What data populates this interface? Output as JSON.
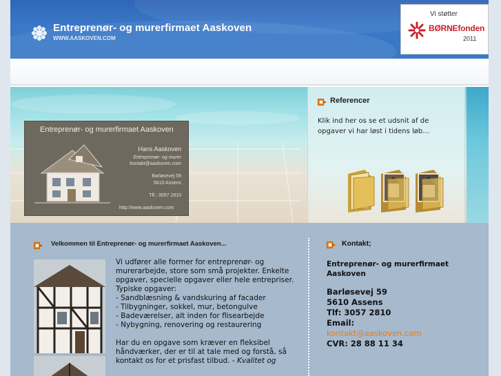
{
  "header": {
    "title": "Entreprenør- og murerfirmaet Aaskoven",
    "url": "WWW.AASKOVEN.COM"
  },
  "badge": {
    "top_text": "Vi støtter",
    "name": "BØRNEfonden",
    "year": "2011"
  },
  "card": {
    "title": "Entreprenør- og murerfirmaet Aaskoven",
    "name": "Hans Aaskoven",
    "role": "Entreprenør- og murer",
    "email": "kontakt@aaskoven.com",
    "address_line1": "Barløsevej 59",
    "address_line2": "5610 Assens",
    "phone": "Tlf.: 3057 2810",
    "web": "http://www.aaskoven.com"
  },
  "references": {
    "title": "Referencer",
    "text": "Klik ind her os se et udsnit af de opgaver vi har løst i tidens  løb...",
    "folder_icons": [
      "folder-icon",
      "folder-photo-icon",
      "folder-photo-icon"
    ]
  },
  "welcome": {
    "title": "Velkommen til Entreprenør- og murerfirmaet Aaskoven...",
    "paragraph1": "Vi udfører alle former for entreprenør- og murerarbejde, store som små projekter. Enkelte opgaver, specielle opgaver eller hele entrepriser.",
    "list_heading": "Typiske opgaver:",
    "items": [
      "- Sandblæsning & vandskuring af facader",
      "- Tilbygninger, sokkel, mur, betongulve",
      "- Badeværelser, alt inden for flisearbejde",
      "- Nybygning, renovering og restaurering"
    ],
    "paragraph2": "Har du en opgave som kræver en fleksibel håndværker, der er til at tale med og forstå, så kontakt os for et prisfast tilbud.",
    "paragraph2_italic": "- Kvalitet og"
  },
  "contact": {
    "title": "Kontakt;",
    "company": "Entreprenør- og murerfirmaet Aaskoven",
    "address": "Barløsevej 59",
    "city": "5610 Assens",
    "phone": "Tlf:  3057 2810",
    "email_label": "Email:",
    "email": "kontakt@aaskoven.com",
    "cvr": "CVR: 28 88 11 34"
  },
  "colors": {
    "header_blue": "#3a78c8",
    "content_blue": "#a6b9cd",
    "email_orange": "#f07a12",
    "badge_red": "#c8202a"
  }
}
